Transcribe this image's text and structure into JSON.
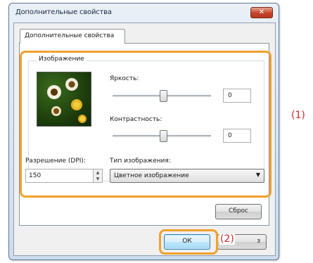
{
  "window": {
    "title": "Дополнительные свойства",
    "close_label": "✕"
  },
  "tabs": [
    {
      "label": "Дополнительные свойства",
      "selected": true
    }
  ],
  "image_group": {
    "label": "Изображение",
    "brightness": {
      "label": "Яркость:",
      "value": "0",
      "slider_level_percent": 50
    },
    "contrast": {
      "label": "Контрастность:",
      "value": "0",
      "slider_level_percent": 50
    }
  },
  "resolution": {
    "label": "Разрешение (DPI):",
    "value": "150"
  },
  "image_type": {
    "label": "Тип изображения:",
    "selected": "Цветное изображение"
  },
  "buttons": {
    "reset": "Сброс",
    "ok": "ОК",
    "cancel_partial": "з"
  },
  "annotations": {
    "callout_1": "(1)",
    "callout_2": "(2)"
  },
  "colors": {
    "highlight": "#f0a12c",
    "annotation": "#d9252a"
  }
}
